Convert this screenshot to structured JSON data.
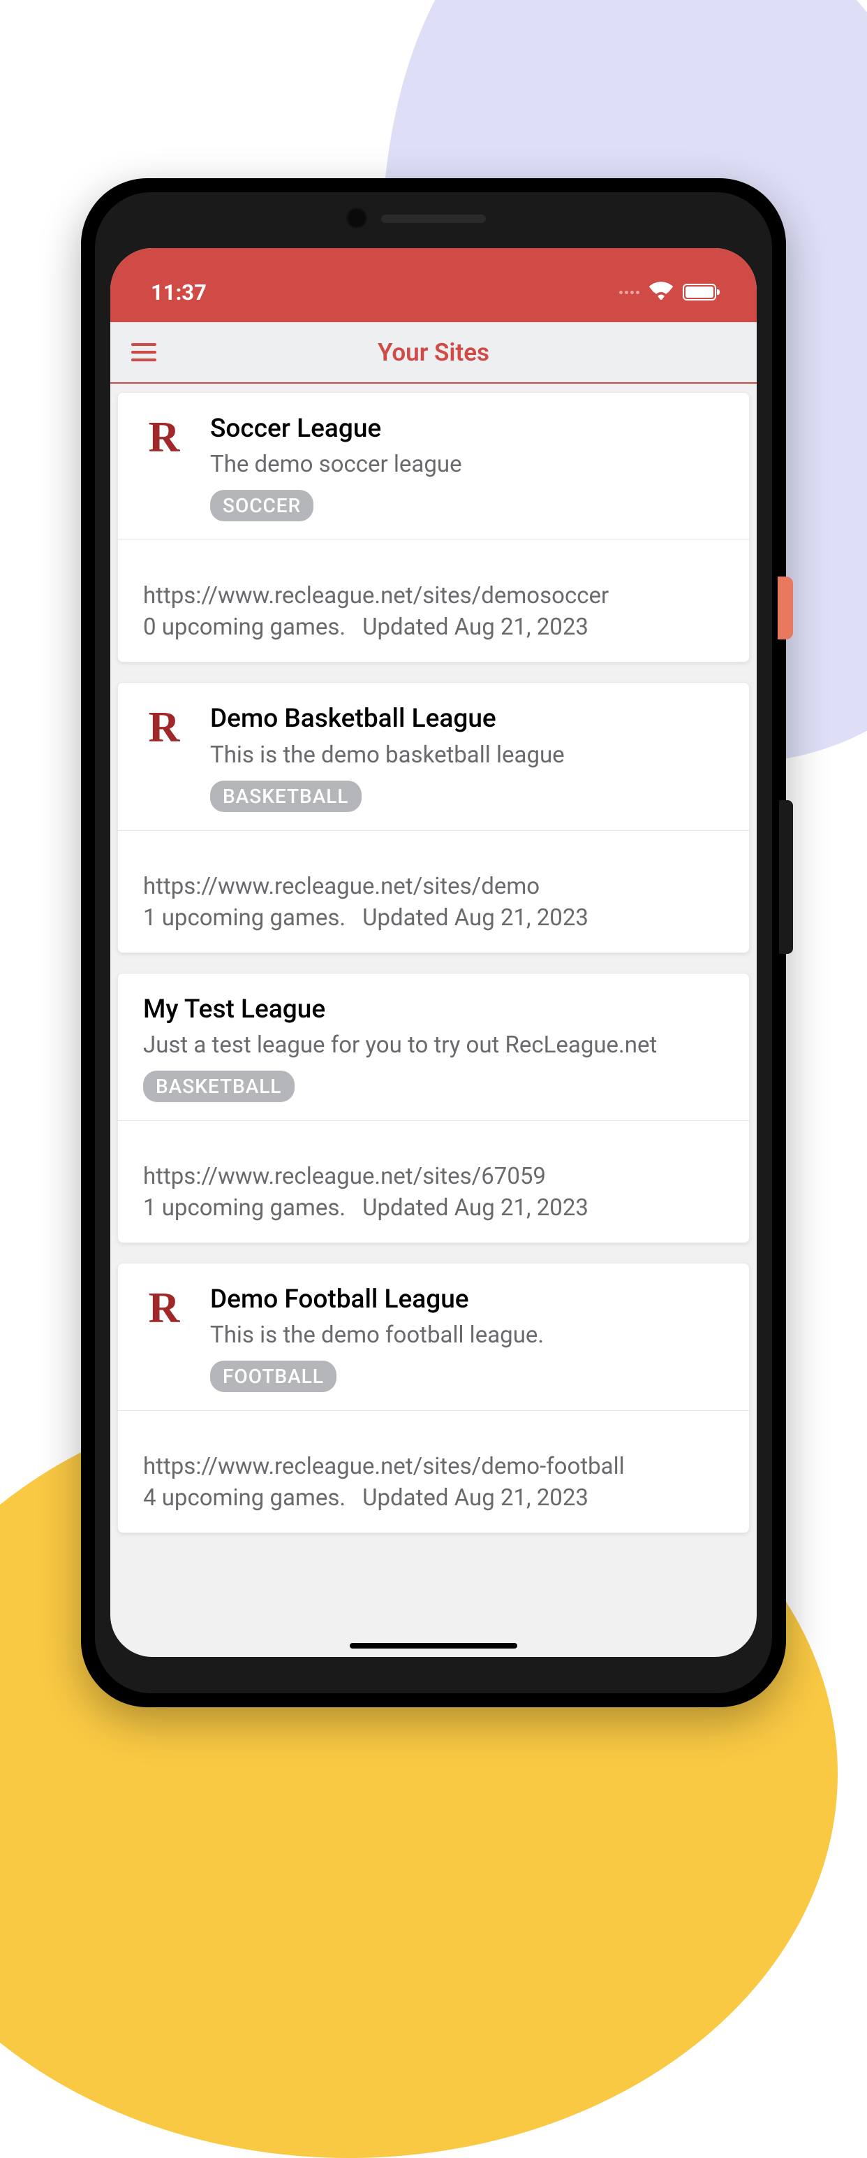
{
  "statusBar": {
    "time": "11:37"
  },
  "appBar": {
    "title": "Your Sites"
  },
  "sites": [
    {
      "hasLogo": true,
      "title": "Soccer League",
      "subtitle": "The demo soccer league",
      "badge": "SOCCER",
      "url": "https://www.recleague.net/sites/demosoccer",
      "upcoming": "0 upcoming games.",
      "updated": "Updated Aug 21, 2023"
    },
    {
      "hasLogo": true,
      "title": "Demo Basketball League",
      "subtitle": "This is the demo basketball league",
      "badge": "BASKETBALL",
      "url": "https://www.recleague.net/sites/demo",
      "upcoming": "1 upcoming games.",
      "updated": "Updated Aug 21, 2023"
    },
    {
      "hasLogo": false,
      "title": "My Test League",
      "subtitle": "Just a test league for you to try out RecLeague.net",
      "badge": "BASKETBALL",
      "url": "https://www.recleague.net/sites/67059",
      "upcoming": "1 upcoming games.",
      "updated": "Updated Aug 21, 2023"
    },
    {
      "hasLogo": true,
      "title": "Demo Football League",
      "subtitle": "This is the demo football league.",
      "badge": "FOOTBALL",
      "url": "https://www.recleague.net/sites/demo-football",
      "upcoming": "4 upcoming games.",
      "updated": "Updated Aug 21, 2023"
    }
  ]
}
